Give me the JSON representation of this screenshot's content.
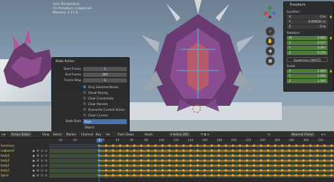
{
  "viewport": {
    "title": "User Perspective",
    "subtitle": "(1) Armature | Legbone3",
    "subtitle2": "Memory: 4.11 G"
  },
  "bake_action": {
    "title": "Bake Action",
    "start_frame_label": "Start Frame",
    "start_frame": "1",
    "end_frame_label": "End Frame",
    "end_frame": "300",
    "frame_step_label": "Frame Step",
    "frame_step": "1",
    "options": [
      {
        "label": "Only Selected Bones",
        "checked": true
      },
      {
        "label": "Visual Keying",
        "checked": false
      },
      {
        "label": "Clear Constraints",
        "checked": false
      },
      {
        "label": "Clear Parents",
        "checked": false
      },
      {
        "label": "Overwrite Current Action",
        "checked": false
      },
      {
        "label": "Clean Curves",
        "checked": false
      }
    ],
    "bake_data_label": "Bake Data",
    "bake_data_selected": "Pose",
    "bake_data_option2": "Object"
  },
  "transform_panel": {
    "title": "Transform",
    "location_label": "Location:",
    "location": [
      {
        "axis": "X",
        "value": "0 m"
      },
      {
        "axis": "Y",
        "value": "-0.000021 m"
      },
      {
        "axis": "Z",
        "value": "0 m"
      }
    ],
    "rotation_label": "Rotation:",
    "rotation": [
      {
        "axis": "W",
        "value": "0.966"
      },
      {
        "axis": "X",
        "value": "0.017"
      },
      {
        "axis": "Y",
        "value": "0.097"
      },
      {
        "axis": "Z",
        "value": "-0.258"
      }
    ],
    "rotation_mode": "Quaternion (WXYZ)",
    "scale_label": "Scale:",
    "scale": [
      {
        "axis": "X",
        "value": "1.000"
      },
      {
        "axis": "Y",
        "value": "1.000"
      },
      {
        "axis": "Z",
        "value": "1.000"
      }
    ]
  },
  "timeline": {
    "editor": "Action Editor",
    "menu": [
      "View",
      "Select",
      "Marker",
      "Channel",
      "Key"
    ],
    "push_down": "Push Down",
    "stash": "Stash",
    "action_name": "Action.001",
    "nearest_frame": "Nearest Frame",
    "ticks": [
      "-40",
      "-20",
      "0",
      "20",
      "40",
      "60",
      "80",
      "100",
      "120",
      "140",
      "160",
      "180",
      "200",
      "220",
      "240",
      "260",
      "280",
      "300",
      "320"
    ],
    "current_frame": "0",
    "channels": [
      "Summary",
      "Legbone3",
      "body4",
      "body3",
      "body2",
      "body1",
      "Spine"
    ]
  },
  "colors": {
    "accent": "#4772b3",
    "keyframe": "#e8a52a",
    "channel_text": "#e8c766"
  }
}
